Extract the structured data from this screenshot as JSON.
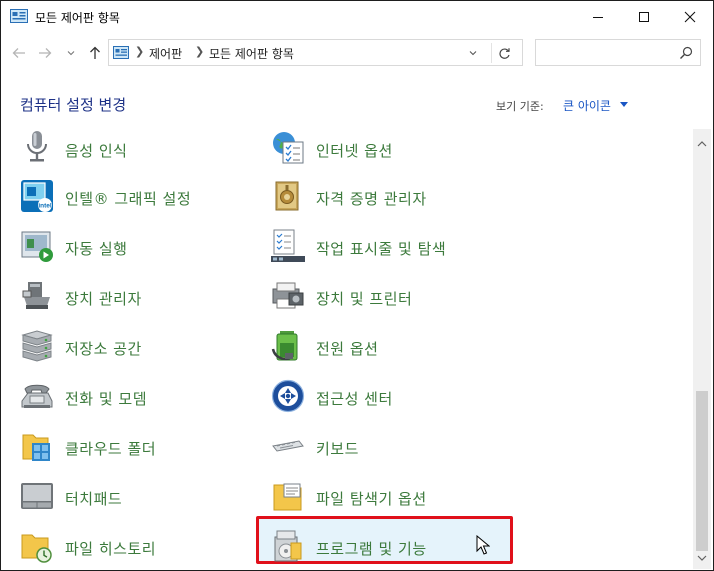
{
  "window": {
    "title": "모든 제어판 항목"
  },
  "navigation": {
    "breadcrumb": [
      "제어판",
      "모든 제어판 항목"
    ]
  },
  "header": {
    "title": "컴퓨터 설정 변경",
    "view_by_label": "보기 기준:",
    "view_by_value": "큰 아이콘"
  },
  "items_left": [
    {
      "label": "음성 인식",
      "icon": "microphone-icon"
    },
    {
      "label": "인텔® 그래픽 설정",
      "icon": "intel-graphics-icon"
    },
    {
      "label": "자동 실행",
      "icon": "autoplay-icon"
    },
    {
      "label": "장치 관리자",
      "icon": "device-manager-icon"
    },
    {
      "label": "저장소 공간",
      "icon": "storage-spaces-icon"
    },
    {
      "label": "전화 및 모뎀",
      "icon": "phone-modem-icon"
    },
    {
      "label": "클라우드 폴더",
      "icon": "work-folders-icon"
    },
    {
      "label": "터치패드",
      "icon": "touchpad-icon"
    },
    {
      "label": "파일 히스토리",
      "icon": "file-history-icon"
    }
  ],
  "items_right": [
    {
      "label": "인터넷 옵션",
      "icon": "internet-options-icon"
    },
    {
      "label": "자격 증명 관리자",
      "icon": "credential-manager-icon"
    },
    {
      "label": "작업 표시줄 및 탐색",
      "icon": "taskbar-icon"
    },
    {
      "label": "장치 및 프린터",
      "icon": "devices-printers-icon"
    },
    {
      "label": "전원 옵션",
      "icon": "power-options-icon"
    },
    {
      "label": "접근성 센터",
      "icon": "ease-of-access-icon"
    },
    {
      "label": "키보드",
      "icon": "keyboard-icon"
    },
    {
      "label": "파일 탐색기 옵션",
      "icon": "file-explorer-options-icon"
    },
    {
      "label": "프로그램 및 기능",
      "icon": "programs-features-icon"
    }
  ],
  "colors": {
    "item_text": "#3c7a3c",
    "header_title": "#1e3287",
    "link": "#1a56c4",
    "highlight_border": "#e0101a",
    "highlight_fill": "#e5f3fb"
  }
}
